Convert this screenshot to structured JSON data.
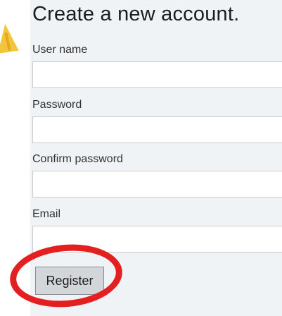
{
  "form": {
    "title": "Create a new account.",
    "fields": [
      {
        "label": "User name",
        "value": "",
        "placeholder": ""
      },
      {
        "label": "Password",
        "value": "",
        "placeholder": ""
      },
      {
        "label": "Confirm password",
        "value": "",
        "placeholder": ""
      },
      {
        "label": "Email",
        "value": "",
        "placeholder": ""
      }
    ],
    "submit_label": "Register"
  },
  "colors": {
    "panel_background": "#f0f3f6",
    "button_background": "#d3d6d9",
    "highlight_ring": "#e41f1f",
    "decor_shape": "#f3c53a"
  },
  "icons": {
    "decor": "warning-triangle-icon"
  }
}
